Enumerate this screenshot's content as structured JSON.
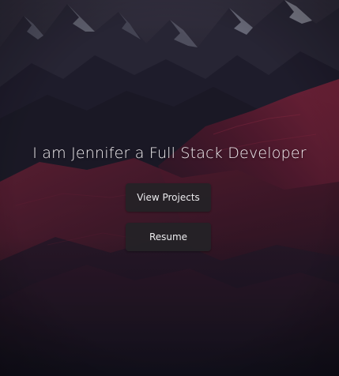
{
  "hero": {
    "headline": "I am Jennifer a Full Stack Developer",
    "background_image": "mountain-landscape-at-dusk"
  },
  "actions": {
    "view_projects_label": "View Projects",
    "resume_label": "Resume"
  },
  "colors": {
    "sky": "#2a2634",
    "ridge_dark": "#1b1a27",
    "ridge_red": "#7a1f34",
    "snow": "#b8bac6",
    "button_bg": "#242226",
    "text": "#f2eef1"
  }
}
